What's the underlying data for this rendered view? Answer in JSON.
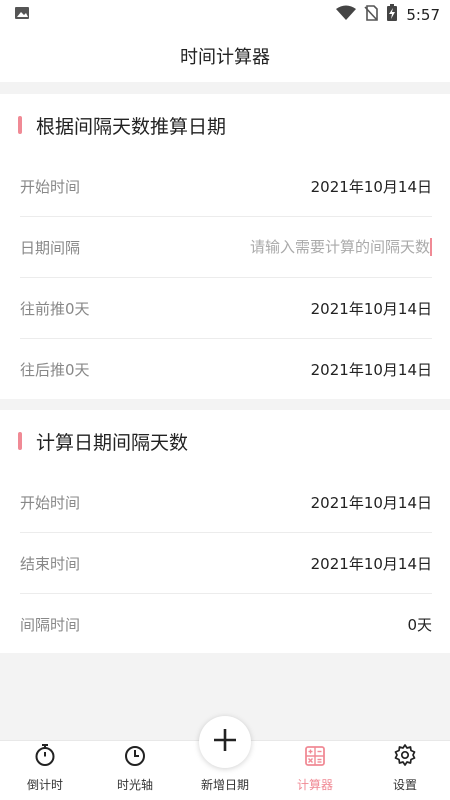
{
  "status_bar": {
    "time": "5:57"
  },
  "header": {
    "title": "时间计算器"
  },
  "section_date_from_interval": {
    "title": "根据间隔天数推算日期",
    "rows": [
      {
        "label": "开始时间",
        "value": "2021年10月14日"
      },
      {
        "label": "日期间隔",
        "placeholder": "请输入需要计算的间隔天数"
      },
      {
        "label": "往前推0天",
        "value": "2021年10月14日"
      },
      {
        "label": "往后推0天",
        "value": "2021年10月14日"
      }
    ]
  },
  "section_interval_between_dates": {
    "title": "计算日期间隔天数",
    "rows": [
      {
        "label": "开始时间",
        "value": "2021年10月14日"
      },
      {
        "label": "结束时间",
        "value": "2021年10月14日"
      },
      {
        "label": "间隔时间",
        "value": "0天"
      }
    ]
  },
  "tabbar": {
    "tabs": [
      {
        "label": "倒计时",
        "icon": "stopwatch-icon"
      },
      {
        "label": "时光轴",
        "icon": "clock-icon"
      },
      {
        "label": "新增日期",
        "icon": "plus-icon"
      },
      {
        "label": "计算器",
        "icon": "calculator-icon",
        "active": true
      },
      {
        "label": "设置",
        "icon": "gear-icon"
      }
    ]
  },
  "colors": {
    "accent": "#f08a95",
    "background": "#f3f3f3"
  }
}
